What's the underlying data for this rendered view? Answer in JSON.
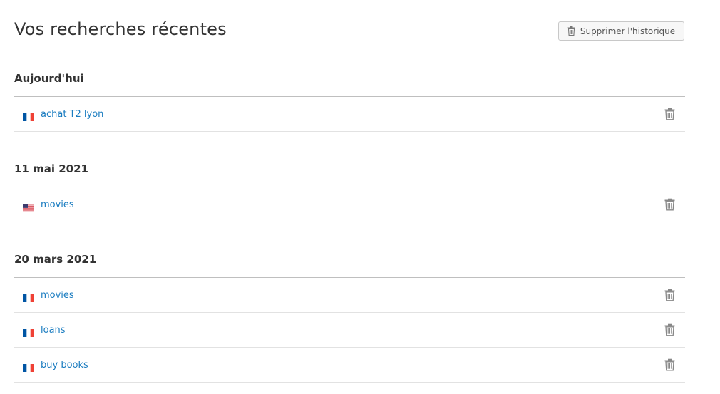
{
  "header": {
    "title": "Vos recherches récentes",
    "clear_label": "Supprimer l'historique"
  },
  "groups": [
    {
      "date": "Aujourd'hui",
      "items": [
        {
          "query": "achat T2 lyon",
          "flag": "fr-flag-icon"
        }
      ]
    },
    {
      "date": "11 mai 2021",
      "items": [
        {
          "query": "movies",
          "flag": "us-flag-icon"
        }
      ]
    },
    {
      "date": "20 mars 2021",
      "items": [
        {
          "query": "movies",
          "flag": "fr-flag-icon"
        },
        {
          "query": "loans",
          "flag": "fr-flag-icon"
        },
        {
          "query": "buy books",
          "flag": "fr-flag-icon"
        }
      ]
    }
  ],
  "colors": {
    "link": "#1a7cc0",
    "icon": "#888888",
    "fr_blue": "#0055a4",
    "fr_red": "#ef4135",
    "us_red": "#d22f3d",
    "us_blue": "#3c3b6e"
  }
}
